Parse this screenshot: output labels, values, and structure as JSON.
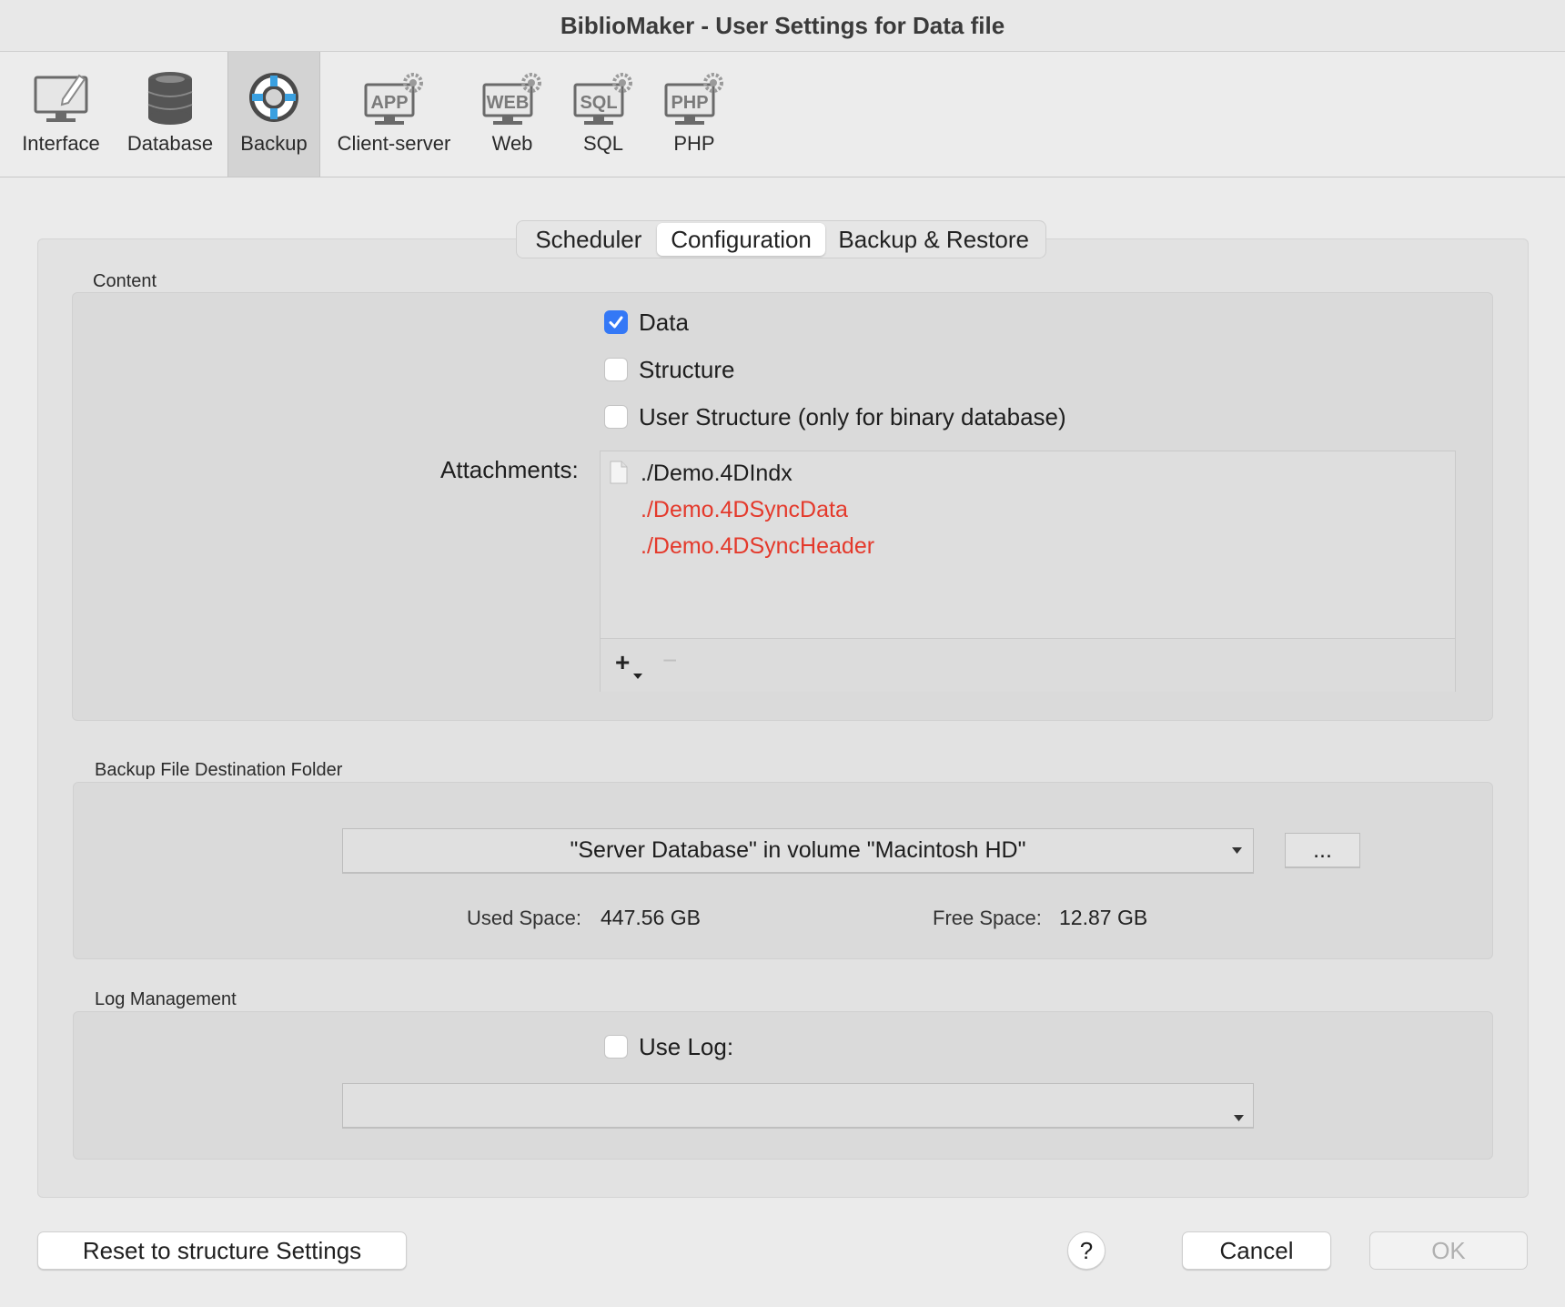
{
  "window": {
    "title": "BiblioMaker - User Settings for Data file"
  },
  "toolbar": {
    "items": [
      {
        "label": "Interface",
        "icon": "monitor-pencil-icon"
      },
      {
        "label": "Database",
        "icon": "database-icon"
      },
      {
        "label": "Backup",
        "icon": "lifebuoy-icon",
        "selected": true
      },
      {
        "label": "Client-server",
        "icon": "app-server-icon"
      },
      {
        "label": "Web",
        "icon": "web-server-icon"
      },
      {
        "label": "SQL",
        "icon": "sql-server-icon"
      },
      {
        "label": "PHP",
        "icon": "php-server-icon"
      }
    ]
  },
  "tabs": [
    {
      "label": "Scheduler"
    },
    {
      "label": "Configuration",
      "selected": true
    },
    {
      "label": "Backup & Restore"
    }
  ],
  "content": {
    "title": "Content",
    "checkboxes": [
      {
        "label": "Data",
        "checked": true
      },
      {
        "label": "Structure",
        "checked": false
      },
      {
        "label": "User Structure (only for binary database)",
        "checked": false
      }
    ],
    "attachments_label": "Attachments:",
    "attachments": [
      {
        "path": "./Demo.4DIndx",
        "missing": false
      },
      {
        "path": "./Demo.4DSyncData",
        "missing": true
      },
      {
        "path": "./Demo.4DSyncHeader",
        "missing": true
      }
    ],
    "add_symbol": "+",
    "remove_symbol": "−"
  },
  "destination": {
    "title": "Backup File Destination Folder",
    "folder": "\"Server Database\" in volume \"Macintosh HD\"",
    "browse_label": "...",
    "used_label": "Used Space:",
    "used_value": "447.56 GB",
    "free_label": "Free Space:",
    "free_value": "12.87 GB"
  },
  "log": {
    "title": "Log Management",
    "use_log_label": "Use Log:",
    "use_log_checked": false,
    "log_file": ""
  },
  "buttons": {
    "reset": "Reset to structure Settings",
    "help": "?",
    "cancel": "Cancel",
    "ok": "OK"
  },
  "colors": {
    "accent": "#3478f6",
    "missing_file": "#e4392b"
  }
}
